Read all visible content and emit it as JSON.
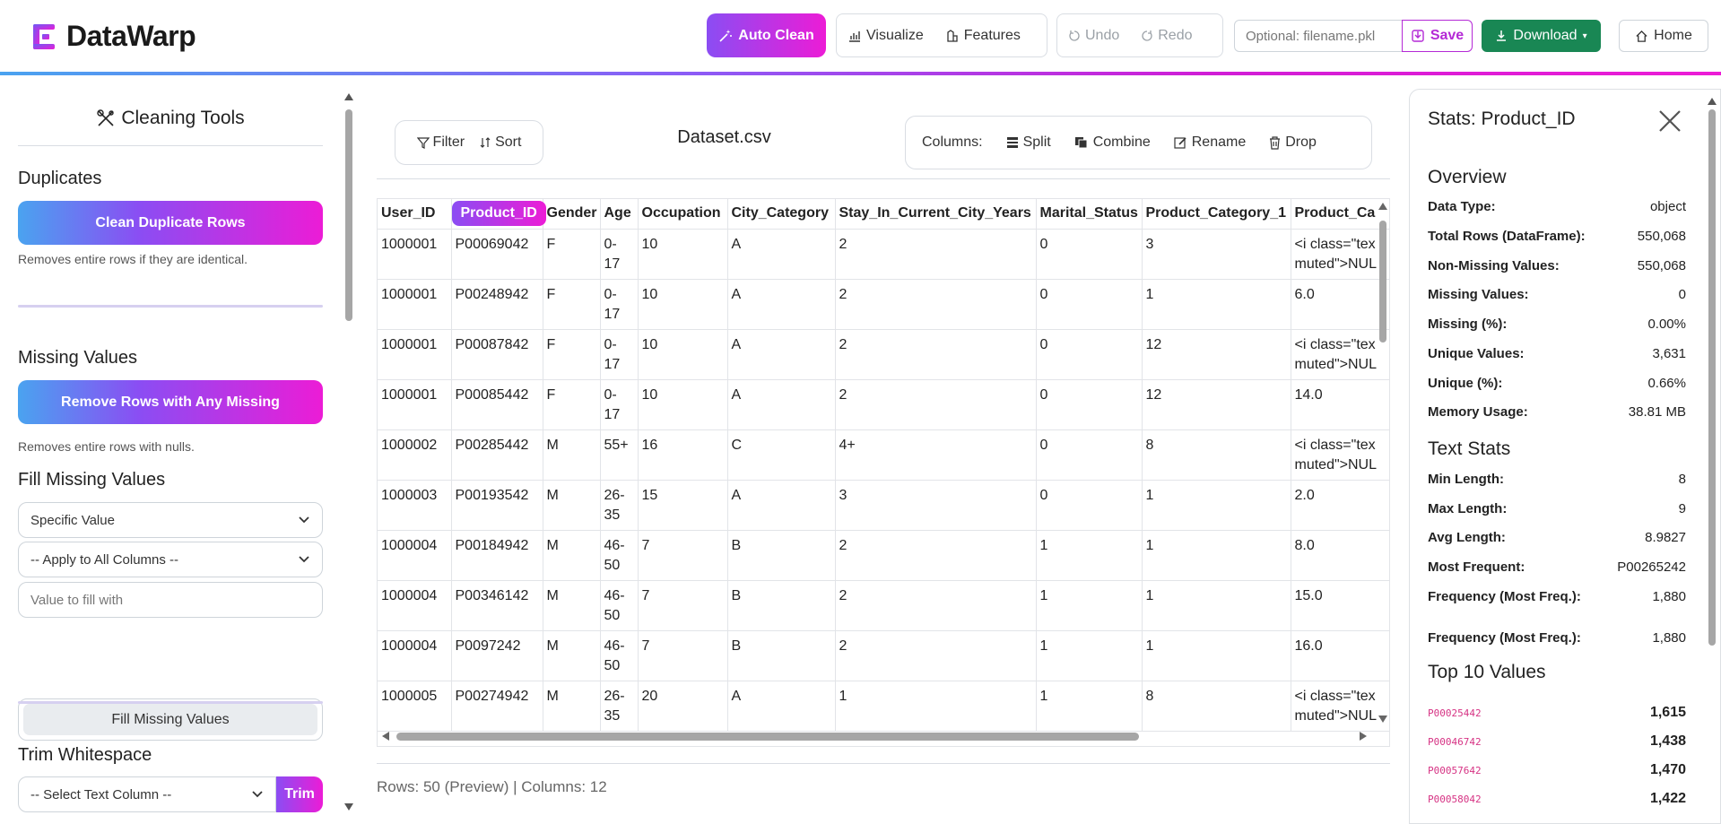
{
  "app": {
    "name": "DataWarp"
  },
  "toolbar": {
    "auto_clean": "Auto Clean",
    "visualize": "Visualize",
    "features": "Features",
    "undo": "Undo",
    "redo": "Redo",
    "filename_placeholder": "Optional: filename.pkl",
    "save": "Save",
    "download": "Download",
    "home": "Home"
  },
  "sidebar": {
    "title": "Cleaning Tools",
    "duplicates": {
      "heading": "Duplicates",
      "button": "Clean Duplicate Rows",
      "help": "Removes entire rows if they are identical."
    },
    "missing": {
      "heading": "Missing Values",
      "button": "Remove Rows with Any Missing",
      "help": "Removes entire rows with nulls."
    },
    "fill": {
      "heading": "Fill Missing Values",
      "method": "Specific Value",
      "column": "-- Apply to All Columns --",
      "value_placeholder": "Value to fill with",
      "button": "Fill Missing Values"
    },
    "trim": {
      "heading": "Trim Whitespace",
      "column": "-- Select Text Column --",
      "button": "Trim"
    }
  },
  "main": {
    "filter": "Filter",
    "sort": "Sort",
    "dataset_name": "Dataset.csv",
    "columns_label": "Columns:",
    "split": "Split",
    "combine": "Combine",
    "rename": "Rename",
    "drop": "Drop",
    "footer": "Rows: 50 (Preview) | Columns: 12"
  },
  "table": {
    "columns": [
      "User_ID",
      "Product_ID",
      "Gender",
      "Age",
      "Occupation",
      "City_Category",
      "Stay_In_Current_City_Years",
      "Marital_Status",
      "Product_Category_1",
      "Product_Ca"
    ],
    "active_column": "Product_ID",
    "rows": [
      [
        "1000001",
        "P00069042",
        "F",
        "0-\n17",
        "10",
        "A",
        "2",
        "0",
        "3",
        "<i class=\"tex\nmuted\">NUL"
      ],
      [
        "1000001",
        "P00248942",
        "F",
        "0-\n17",
        "10",
        "A",
        "2",
        "0",
        "1",
        "6.0"
      ],
      [
        "1000001",
        "P00087842",
        "F",
        "0-\n17",
        "10",
        "A",
        "2",
        "0",
        "12",
        "<i class=\"tex\nmuted\">NUL"
      ],
      [
        "1000001",
        "P00085442",
        "F",
        "0-\n17",
        "10",
        "A",
        "2",
        "0",
        "12",
        "14.0"
      ],
      [
        "1000002",
        "P00285442",
        "M",
        "55+",
        "16",
        "C",
        "4+",
        "0",
        "8",
        "<i class=\"tex\nmuted\">NUL"
      ],
      [
        "1000003",
        "P00193542",
        "M",
        "26-\n35",
        "15",
        "A",
        "3",
        "0",
        "1",
        "2.0"
      ],
      [
        "1000004",
        "P00184942",
        "M",
        "46-\n50",
        "7",
        "B",
        "2",
        "1",
        "1",
        "8.0"
      ],
      [
        "1000004",
        "P00346142",
        "M",
        "46-\n50",
        "7",
        "B",
        "2",
        "1",
        "1",
        "15.0"
      ],
      [
        "1000004",
        "P0097242",
        "M",
        "46-\n50",
        "7",
        "B",
        "2",
        "1",
        "1",
        "16.0"
      ],
      [
        "1000005",
        "P00274942",
        "M",
        "26-\n35",
        "20",
        "A",
        "1",
        "1",
        "8",
        "<i class=\"tex\nmuted\">NUL"
      ]
    ]
  },
  "stats": {
    "title": "Stats: Product_ID",
    "overview_heading": "Overview",
    "overview": [
      {
        "k": "Data Type:",
        "v": "object"
      },
      {
        "k": "Total Rows (DataFrame):",
        "v": "550,068"
      },
      {
        "k": "Non-Missing Values:",
        "v": "550,068"
      },
      {
        "k": "Missing Values:",
        "v": "0"
      },
      {
        "k": "Missing (%):",
        "v": "0.00%"
      },
      {
        "k": "Unique Values:",
        "v": "3,631"
      },
      {
        "k": "Unique (%):",
        "v": "0.66%"
      },
      {
        "k": "Memory Usage:",
        "v": "38.81 MB"
      }
    ],
    "text_heading": "Text Stats",
    "text": [
      {
        "k": "Min Length:",
        "v": "8"
      },
      {
        "k": "Max Length:",
        "v": "9"
      },
      {
        "k": "Avg Length:",
        "v": "8.9827"
      },
      {
        "k": "Most Frequent:",
        "v": "P00265242"
      },
      {
        "k": "Frequency (Most Freq.):",
        "v": "1,880"
      },
      {
        "k": "Frequency (Most Freq.):",
        "v": "1,880"
      }
    ],
    "top_heading": "Top 10 Values",
    "top": [
      {
        "k": "P00025442",
        "v": "1,615"
      },
      {
        "k": "P00046742",
        "v": "1,438"
      },
      {
        "k": "P00057642",
        "v": "1,470"
      },
      {
        "k": "P00058042",
        "v": "1,422"
      }
    ]
  },
  "colors": {
    "accent_start": "#8b4df3",
    "accent_end": "#ec1cd6",
    "download": "#198754",
    "code": "#d63384"
  }
}
